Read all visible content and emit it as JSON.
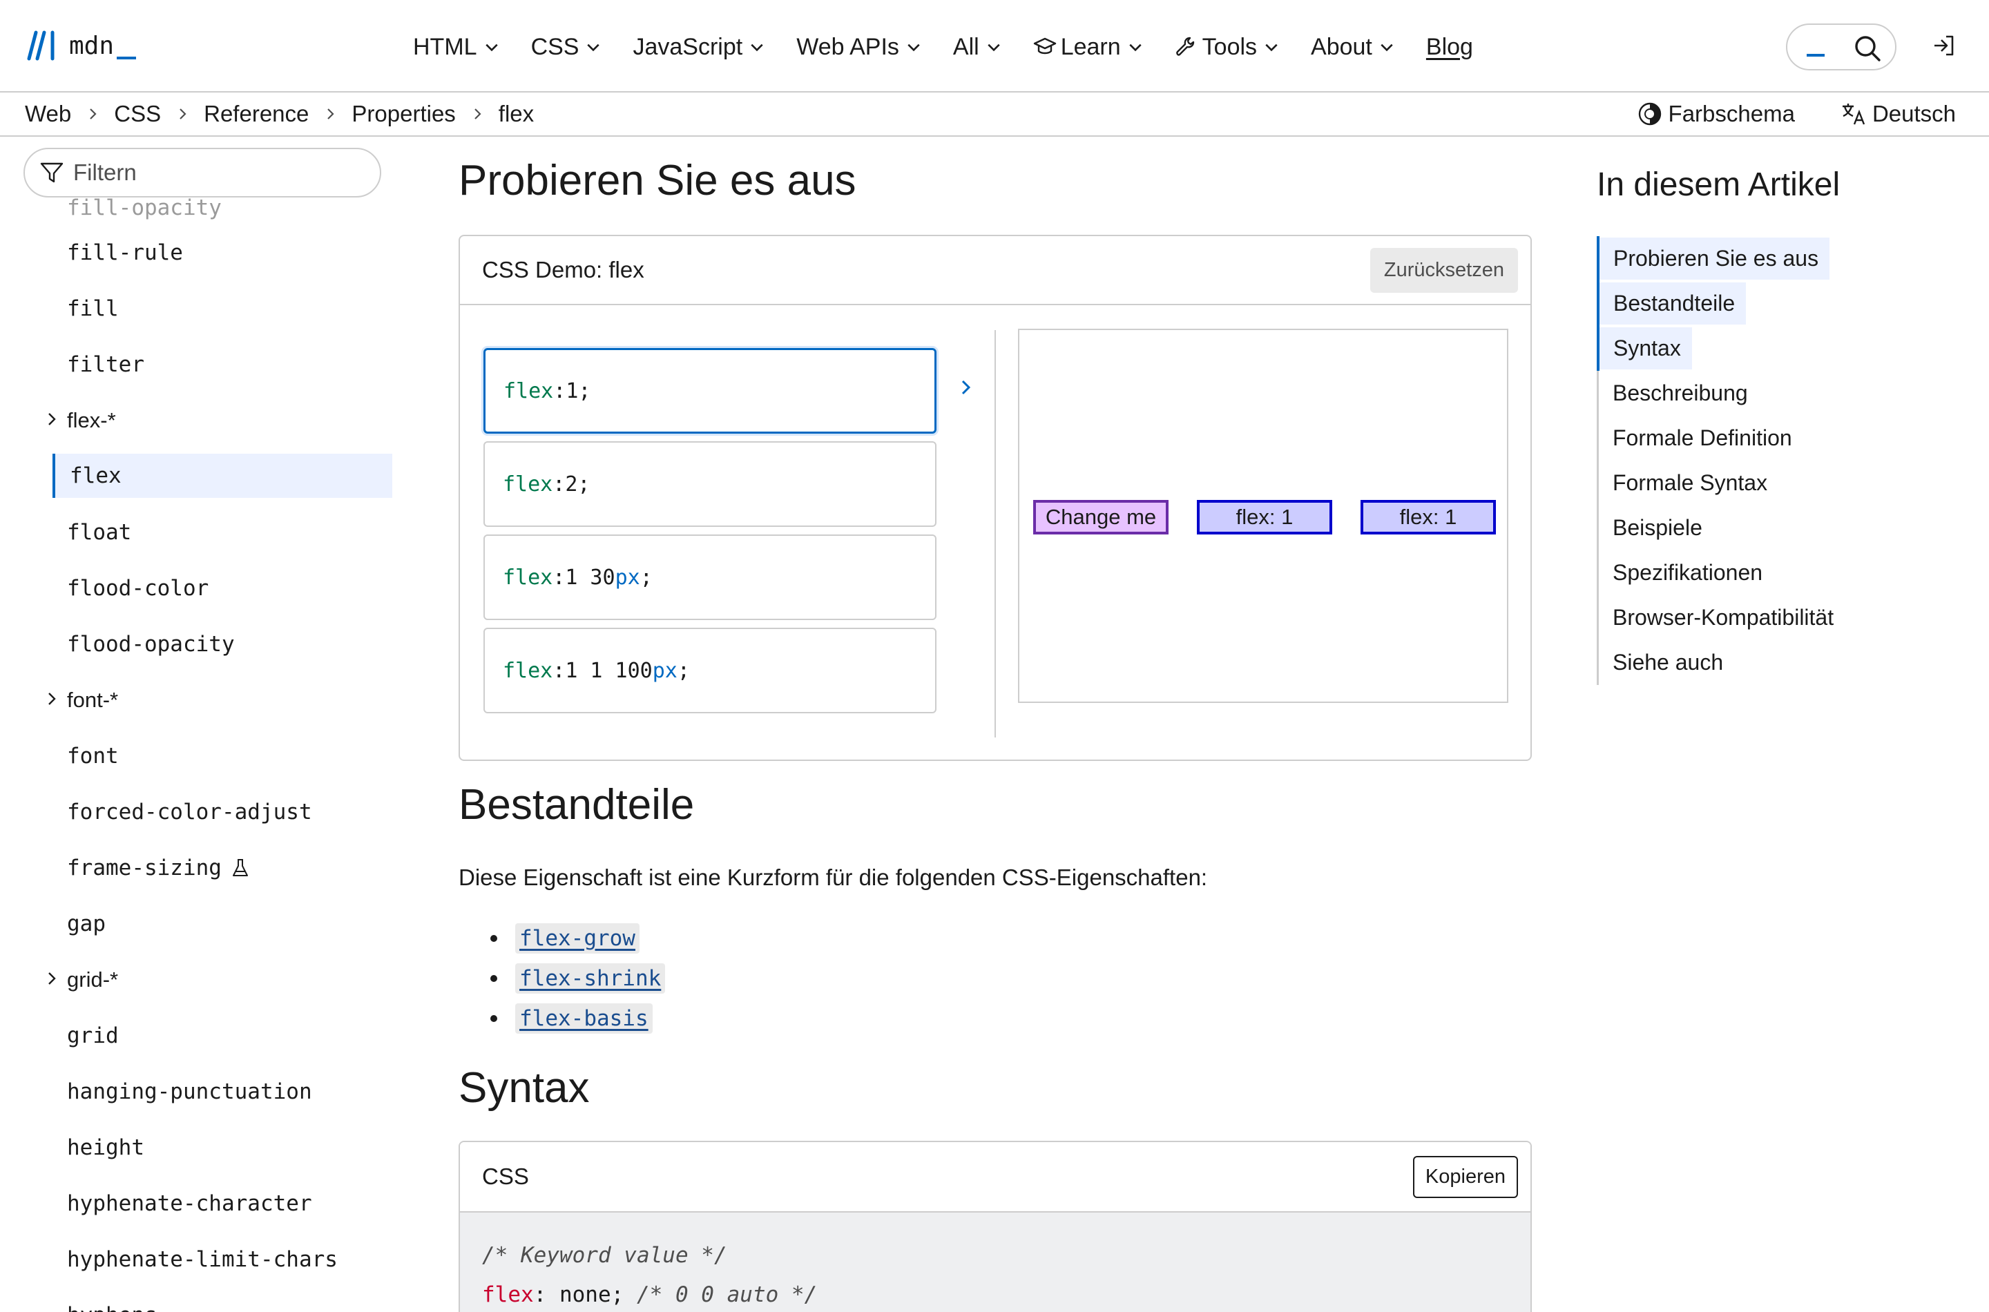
{
  "header": {
    "logo_text": "mdn",
    "nav": [
      {
        "label": "HTML"
      },
      {
        "label": "CSS"
      },
      {
        "label": "JavaScript"
      },
      {
        "label": "Web APIs"
      },
      {
        "label": "All"
      },
      {
        "label": "Learn"
      },
      {
        "label": "Tools"
      },
      {
        "label": "About"
      }
    ],
    "blog": "Blog"
  },
  "breadcrumb": {
    "items": [
      "Web",
      "CSS",
      "Reference",
      "Properties",
      "flex"
    ],
    "color_scheme": "Farbschema",
    "language": "Deutsch"
  },
  "sidebar": {
    "filter_placeholder": "Filtern",
    "items": [
      {
        "label": "fill-opacity"
      },
      {
        "label": "fill-rule"
      },
      {
        "label": "fill"
      },
      {
        "label": "filter"
      },
      {
        "label": "flex-*"
      },
      {
        "label": "flex"
      },
      {
        "label": "float"
      },
      {
        "label": "flood-color"
      },
      {
        "label": "flood-opacity"
      },
      {
        "label": "font-*"
      },
      {
        "label": "font"
      },
      {
        "label": "forced-color-adjust"
      },
      {
        "label": "frame-sizing"
      },
      {
        "label": "gap"
      },
      {
        "label": "grid-*"
      },
      {
        "label": "grid"
      },
      {
        "label": "hanging-punctuation"
      },
      {
        "label": "height"
      },
      {
        "label": "hyphenate-character"
      },
      {
        "label": "hyphenate-limit-chars"
      },
      {
        "label": "hyphens"
      }
    ]
  },
  "main": {
    "try_heading": "Probieren Sie es aus",
    "demo": {
      "title": "CSS Demo: flex",
      "reset": "Zurücksetzen",
      "choices": [
        {
          "prop": "flex",
          "colon": ":",
          "val1": " 1",
          "unit": "",
          "end": ";"
        },
        {
          "prop": "flex",
          "colon": ":",
          "val1": " 2",
          "unit": "",
          "end": ";"
        },
        {
          "prop": "flex",
          "colon": ":",
          "val1": " 1 30",
          "unit": "px",
          "end": ";"
        },
        {
          "prop": "flex",
          "colon": ":",
          "val1": " 1 1 100",
          "unit": "px",
          "end": ";"
        }
      ],
      "boxes": [
        "Change me",
        "flex: 1",
        "flex: 1"
      ]
    },
    "parts_heading": "Bestandteile",
    "parts_text": "Diese Eigenschaft ist eine Kurzform für die folgenden CSS-Eigenschaften:",
    "parts": [
      "flex-grow",
      "flex-shrink",
      "flex-basis"
    ],
    "syntax_heading": "Syntax",
    "code": {
      "lang": "CSS",
      "copy": "Kopieren",
      "line1": "/* Keyword value */",
      "line2_prop": "flex",
      "line2_rest": ": none; ",
      "line2_comment": "/* 0 0 auto */"
    }
  },
  "toc": {
    "title": "In diesem Artikel",
    "items": [
      "Probieren Sie es aus",
      "Bestandteile",
      "Syntax",
      "Beschreibung",
      "Formale Definition",
      "Formale Syntax",
      "Beispiele",
      "Spezifikationen",
      "Browser-Kompatibilität",
      "Siehe auch"
    ]
  }
}
